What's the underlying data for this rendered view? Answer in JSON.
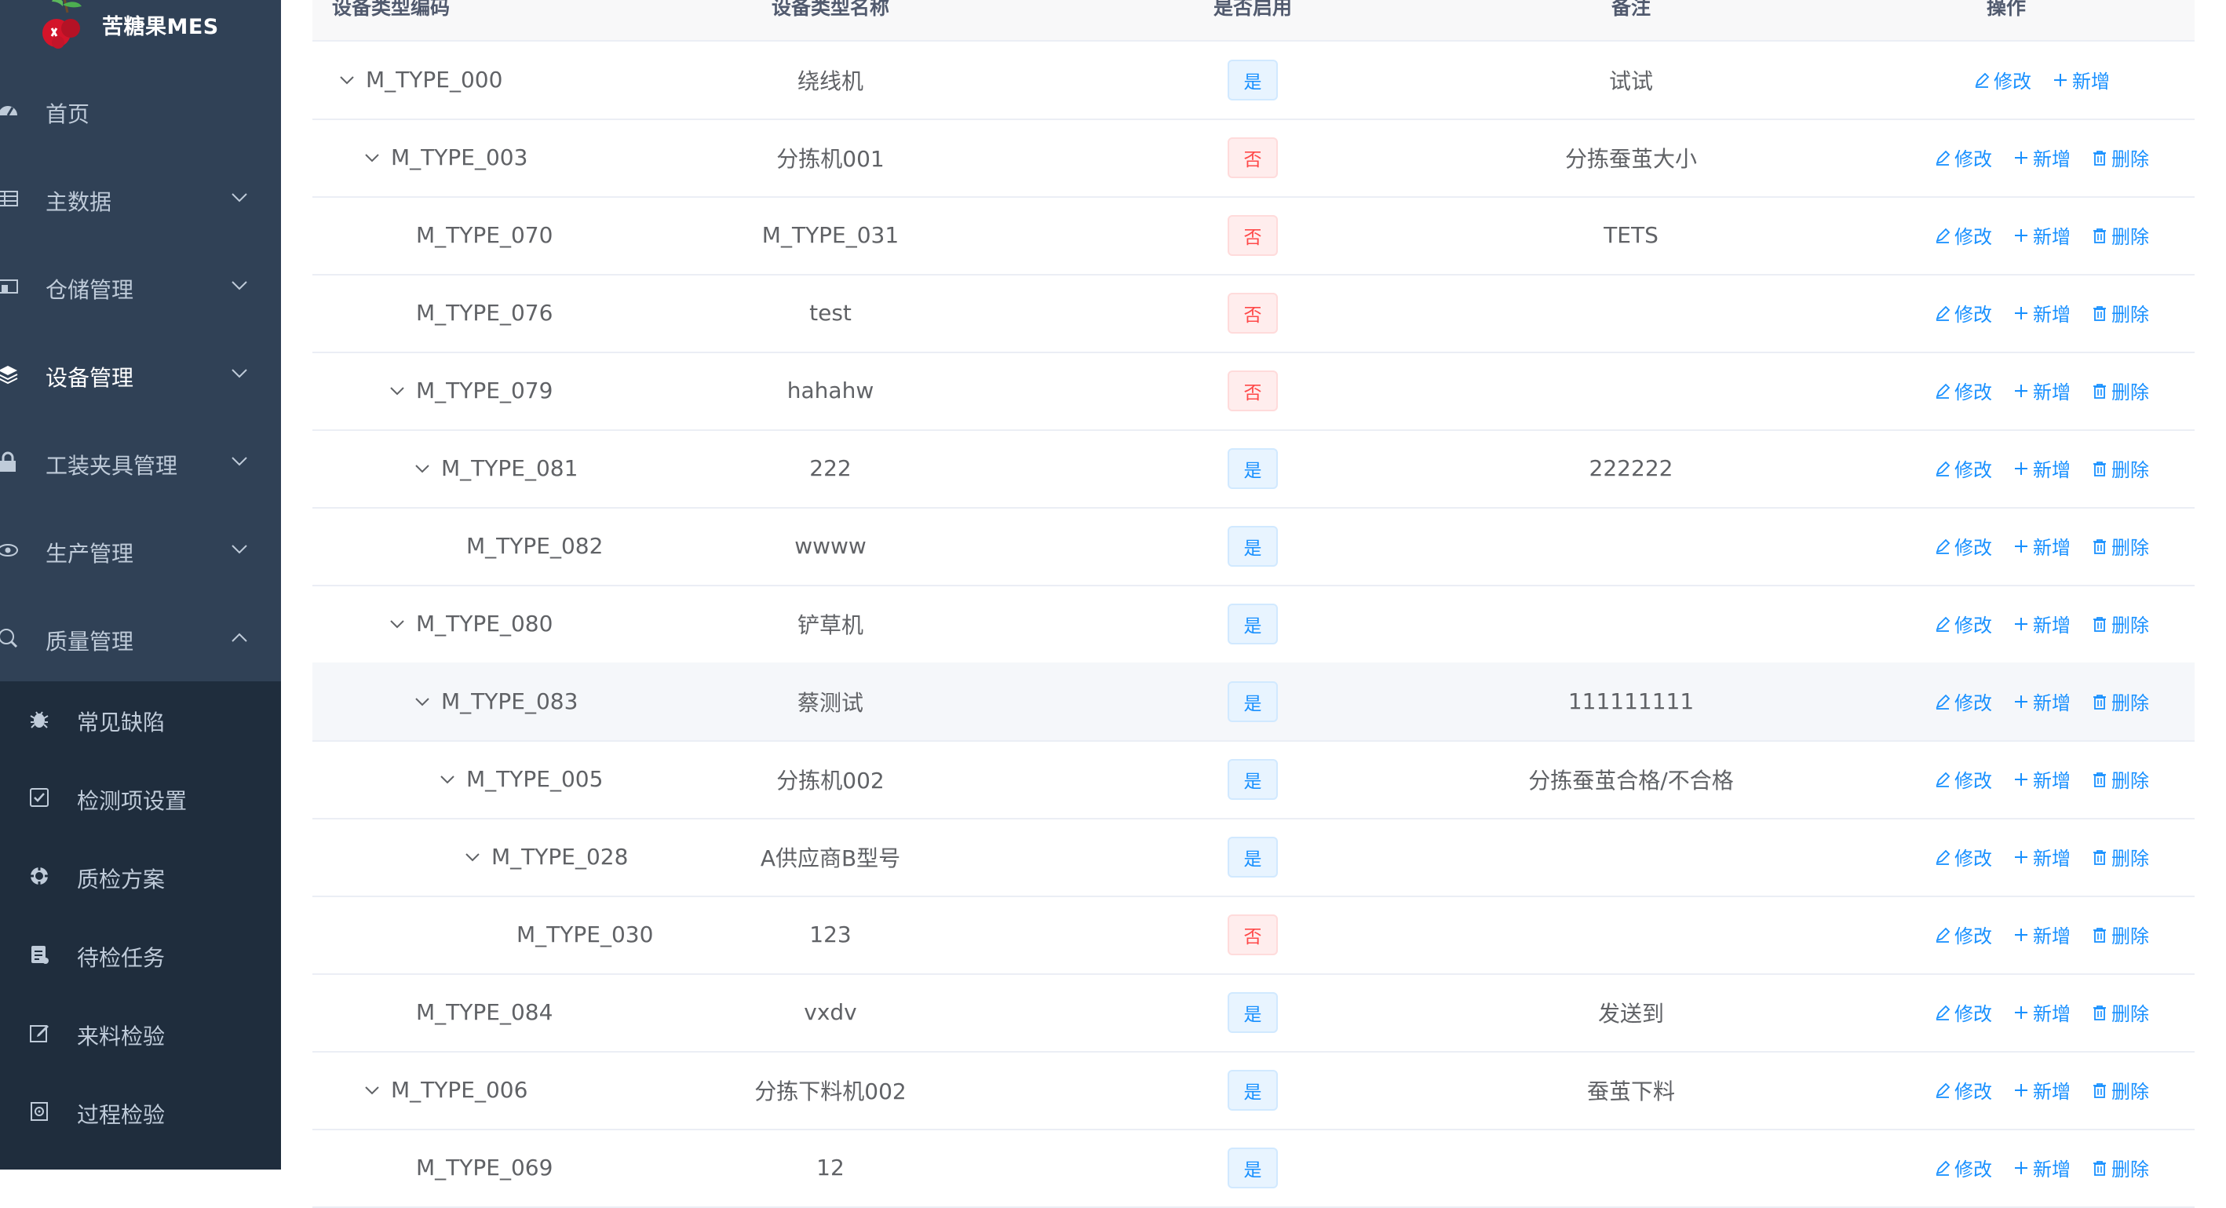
{
  "app": {
    "title": "苦糖果MES"
  },
  "sidebar": {
    "items": [
      {
        "label": "首页",
        "icon": "dashboard-icon",
        "has_arrow": false
      },
      {
        "label": "主数据",
        "icon": "table-icon",
        "has_arrow": true
      },
      {
        "label": "仓储管理",
        "icon": "warehouse-icon",
        "has_arrow": true
      },
      {
        "label": "设备管理",
        "icon": "layers-icon",
        "has_arrow": true,
        "active": true
      },
      {
        "label": "工装夹具管理",
        "icon": "lock-icon",
        "has_arrow": true
      },
      {
        "label": "生产管理",
        "icon": "eye-icon",
        "has_arrow": true
      },
      {
        "label": "质量管理",
        "icon": "quality-icon",
        "has_arrow": true,
        "expanded": true
      }
    ],
    "subitems": [
      {
        "label": "常见缺陷",
        "icon": "bug-icon"
      },
      {
        "label": "检测项设置",
        "icon": "checkbox-icon"
      },
      {
        "label": "质检方案",
        "icon": "target-icon"
      },
      {
        "label": "待检任务",
        "icon": "task-icon"
      },
      {
        "label": "来料检验",
        "icon": "edit-icon"
      },
      {
        "label": "过程检验",
        "icon": "process-icon"
      }
    ]
  },
  "table": {
    "headers": {
      "code": "设备类型编码",
      "name": "设备类型名称",
      "enabled": "是否启用",
      "remark": "备注",
      "actions": "操作"
    },
    "action_labels": {
      "edit": "修改",
      "add": "新增",
      "delete": "删除"
    },
    "tag_labels": {
      "yes": "是",
      "no": "否"
    },
    "rows": [
      {
        "code": "M_TYPE_000",
        "name": "绕线机",
        "enabled": "yes",
        "remark": "试试",
        "level": 0,
        "expandable": true,
        "can_delete": false
      },
      {
        "code": "M_TYPE_003",
        "name": "分拣机001",
        "enabled": "no",
        "remark": "分拣蚕茧大小",
        "level": 1,
        "expandable": true,
        "can_delete": true
      },
      {
        "code": "M_TYPE_070",
        "name": "M_TYPE_031",
        "enabled": "no",
        "remark": "TETS",
        "level": 2,
        "expandable": false,
        "can_delete": true
      },
      {
        "code": "M_TYPE_076",
        "name": "test",
        "enabled": "no",
        "remark": "",
        "level": 2,
        "expandable": false,
        "can_delete": true
      },
      {
        "code": "M_TYPE_079",
        "name": "hahahw",
        "enabled": "no",
        "remark": "",
        "level": 2,
        "expandable": true,
        "can_delete": true
      },
      {
        "code": "M_TYPE_081",
        "name": "222",
        "enabled": "yes",
        "remark": "222222",
        "level": 3,
        "expandable": true,
        "can_delete": true
      },
      {
        "code": "M_TYPE_082",
        "name": "wwww",
        "enabled": "yes",
        "remark": "",
        "level": 4,
        "expandable": false,
        "can_delete": true
      },
      {
        "code": "M_TYPE_080",
        "name": "铲草机",
        "enabled": "yes",
        "remark": "",
        "level": 2,
        "expandable": true,
        "can_delete": true
      },
      {
        "code": "M_TYPE_083",
        "name": "蔡测试",
        "enabled": "yes",
        "remark": "111111111",
        "level": 3,
        "expandable": true,
        "can_delete": true,
        "hover": true
      },
      {
        "code": "M_TYPE_005",
        "name": "分拣机002",
        "enabled": "yes",
        "remark": "分拣蚕茧合格/不合格",
        "level": 4,
        "expandable": true,
        "can_delete": true
      },
      {
        "code": "M_TYPE_028",
        "name": "A供应商B型号",
        "enabled": "yes",
        "remark": "",
        "level": 5,
        "expandable": true,
        "can_delete": true
      },
      {
        "code": "M_TYPE_030",
        "name": "123",
        "enabled": "no",
        "remark": "",
        "level": 6,
        "expandable": false,
        "can_delete": true
      },
      {
        "code": "M_TYPE_084",
        "name": "vxdv",
        "enabled": "yes",
        "remark": "发送到",
        "level": 2,
        "expandable": false,
        "can_delete": true
      },
      {
        "code": "M_TYPE_006",
        "name": "分拣下料机002",
        "enabled": "yes",
        "remark": "蚕茧下料",
        "level": 1,
        "expandable": true,
        "can_delete": true
      },
      {
        "code": "M_TYPE_069",
        "name": "12",
        "enabled": "yes",
        "remark": "",
        "level": 2,
        "expandable": false,
        "can_delete": true
      }
    ]
  },
  "colors": {
    "sidebar_bg": "#304156",
    "submenu_bg": "#1f2d3d",
    "primary": "#1890ff",
    "danger": "#ff4949"
  }
}
